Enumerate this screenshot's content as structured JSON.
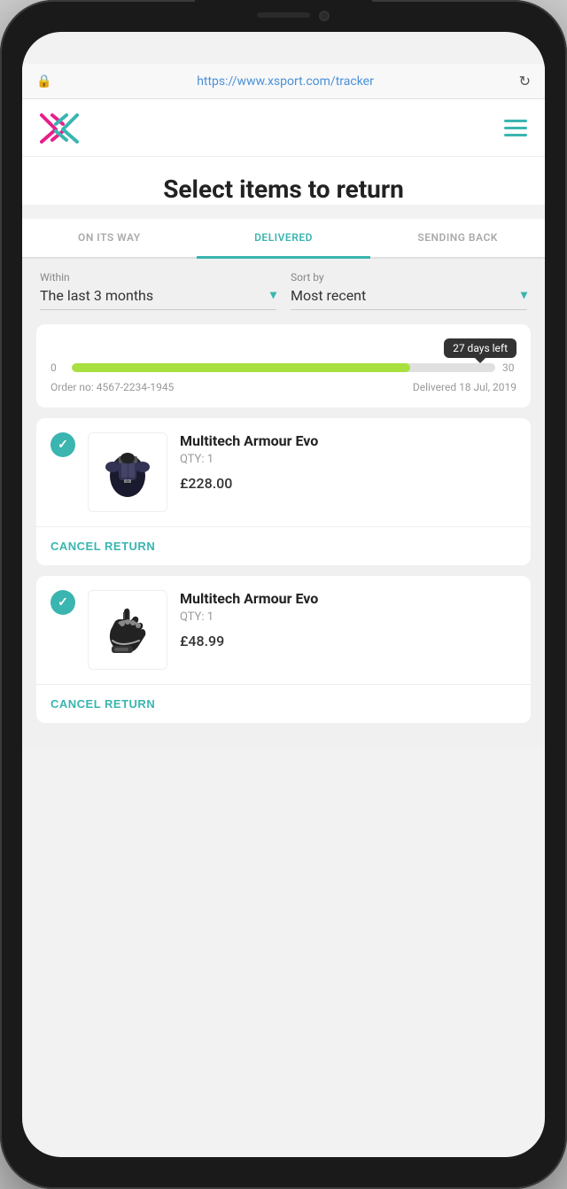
{
  "browser": {
    "url": "https://www.xsport.com/tracker",
    "lock_icon": "🔒",
    "refresh_icon": "↻"
  },
  "header": {
    "menu_icon": "☰"
  },
  "page": {
    "title": "Select items to return"
  },
  "tabs": [
    {
      "id": "on-its-way",
      "label": "ON ITS WAY",
      "state": "inactive"
    },
    {
      "id": "delivered",
      "label": "DELIVERED",
      "state": "active"
    },
    {
      "id": "sending-back",
      "label": "SENDING BACK",
      "state": "inactive"
    }
  ],
  "filters": {
    "within": {
      "label": "Within",
      "value": "The last 3 months"
    },
    "sort_by": {
      "label": "Sort by",
      "value": "Most recent"
    }
  },
  "order": {
    "progress": 80,
    "progress_min": 0,
    "progress_max": 30,
    "tooltip": "27 days left",
    "order_no": "Order no: 4567-2234-1945",
    "delivered": "Delivered 18 Jul, 2019"
  },
  "products": [
    {
      "id": "product-1",
      "name": "Multitech Armour Evo",
      "qty": "QTY: 1",
      "price": "£228.00",
      "checked": true,
      "cancel_label": "CANCEL RETURN",
      "image_type": "armour"
    },
    {
      "id": "product-2",
      "name": "Multitech Armour Evo",
      "qty": "QTY: 1",
      "price": "£48.99",
      "checked": true,
      "cancel_label": "CANCEL RETURN",
      "image_type": "glove"
    }
  ]
}
